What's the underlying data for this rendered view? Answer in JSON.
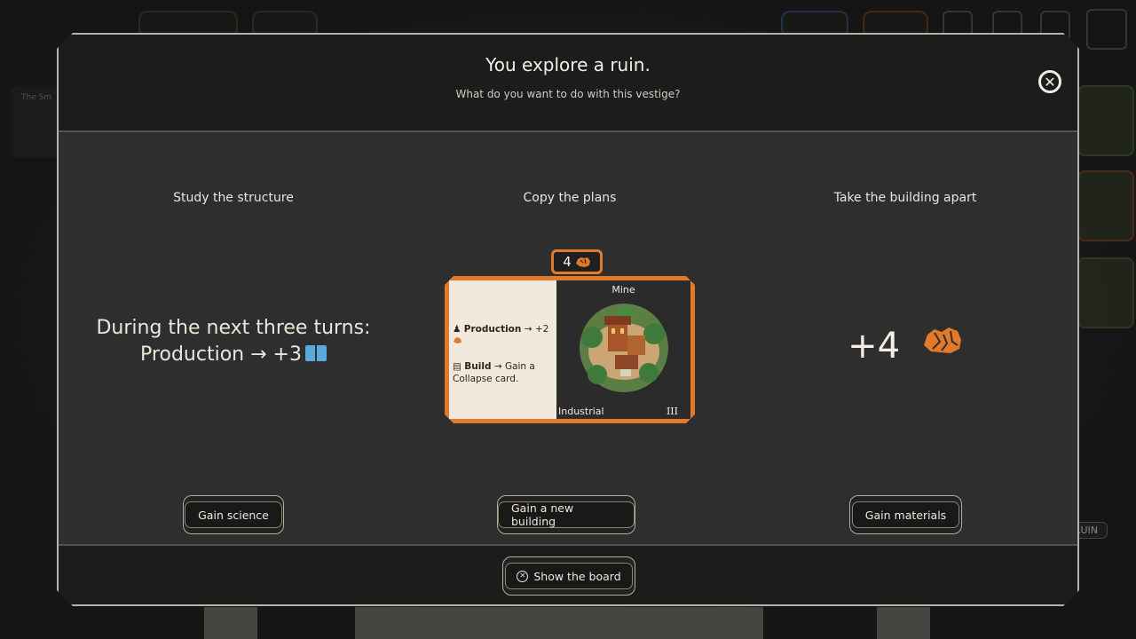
{
  "background": {
    "side_panel_text": "The Sm",
    "ruin_label": "RUIN"
  },
  "modal": {
    "title": "You explore a ruin.",
    "subtitle": "What do you want to do with this vestige?",
    "close_icon": "close-circle-icon"
  },
  "options": [
    {
      "title": "Study the structure",
      "text_line1": "During the next three turns:",
      "text_line2": "Production → +3",
      "icon": "book-icon",
      "button_label": "Gain science"
    },
    {
      "title": "Copy the plans",
      "card": {
        "cost": "4",
        "cost_icon": "ore-icon",
        "name": "Mine",
        "type": "Industrial",
        "tier": "III",
        "production_label": "Production",
        "production_effect": "→ +2",
        "build_label": "Build",
        "build_effect": "→ Gain a Collapse card."
      },
      "button_label": "Gain a new building"
    },
    {
      "title": "Take the building apart",
      "amount": "+4",
      "icon": "ore-icon",
      "button_label": "Gain materials"
    }
  ],
  "footer": {
    "show_board_label": "Show the board"
  },
  "colors": {
    "accent": "#e2792b",
    "science": "#5aa9dd",
    "panel": "#2e2e2e",
    "header": "#1c1c1c"
  }
}
